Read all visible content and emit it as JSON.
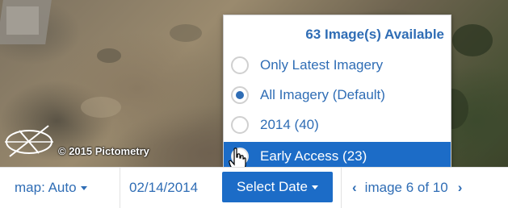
{
  "map": {
    "copyright": "© 2015 Pictometry",
    "compass_icon": "compass-icon"
  },
  "dropdown": {
    "header": "63 Image(s) Available",
    "items": [
      {
        "label": "Only Latest Imagery",
        "selected": false,
        "highlighted": false
      },
      {
        "label": "All Imagery (Default)",
        "selected": true,
        "highlighted": false
      },
      {
        "label": "2014 (40)",
        "selected": false,
        "highlighted": false
      },
      {
        "label": "Early Access (23)",
        "selected": false,
        "highlighted": true
      }
    ]
  },
  "toolbar": {
    "map_label": "map: Auto",
    "date": "02/14/2014",
    "select_date_label": "Select Date",
    "image_counter": "image 6 of 10"
  },
  "colors": {
    "accent": "#2f6db5",
    "highlight": "#1c6cc7"
  }
}
